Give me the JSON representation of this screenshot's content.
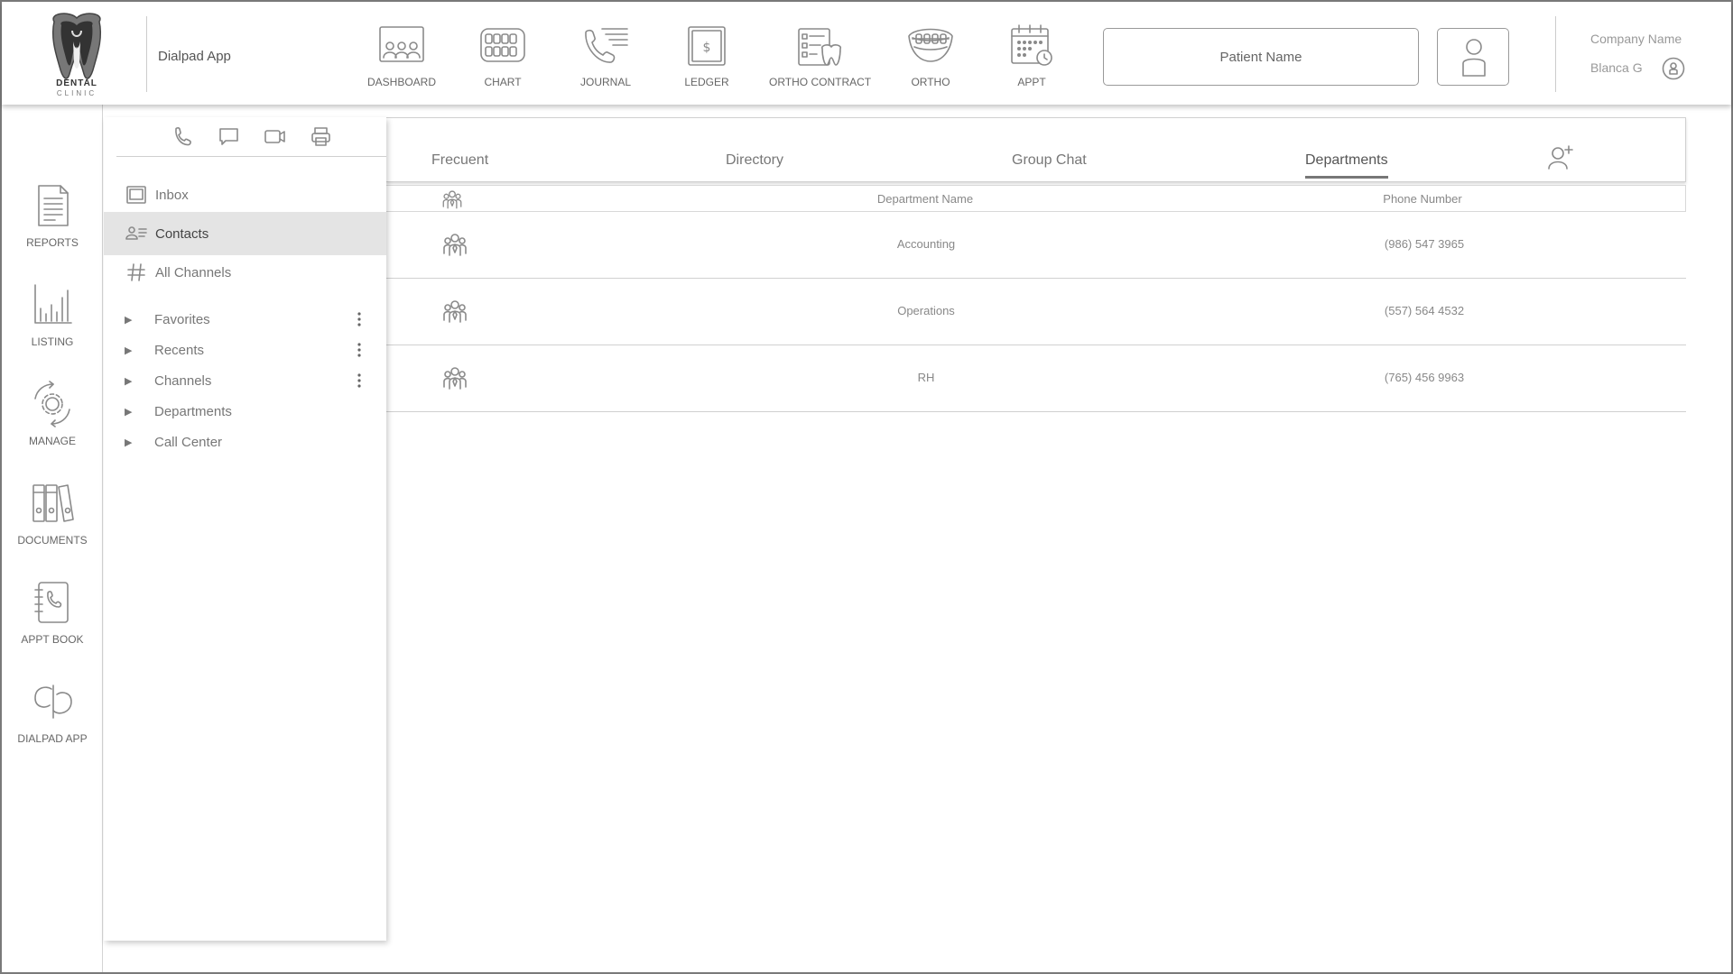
{
  "logo": {
    "text": "DENTAL",
    "subtext": "CLINIC"
  },
  "app_title": "Dialpad App",
  "top_nav": [
    {
      "label": "DASHBOARD",
      "icon": "dashboard-icon"
    },
    {
      "label": "CHART",
      "icon": "teeth-chart-icon"
    },
    {
      "label": "JOURNAL",
      "icon": "journal-icon"
    },
    {
      "label": "LEDGER",
      "icon": "ledger-icon"
    },
    {
      "label": "ORTHO CONTRACT",
      "icon": "ortho-contract-icon"
    },
    {
      "label": "ORTHO",
      "icon": "braces-icon"
    },
    {
      "label": "APPT",
      "icon": "calendar-icon"
    }
  ],
  "patient_search": {
    "placeholder": "Patient Name"
  },
  "account": {
    "company": "Company Name",
    "user": "Blanca G"
  },
  "left_rail": [
    {
      "label": "REPORTS",
      "icon": "report-icon"
    },
    {
      "label": "LISTING",
      "icon": "bar-chart-icon"
    },
    {
      "label": "MANAGE",
      "icon": "gear-cycle-icon"
    },
    {
      "label": "DOCUMENTS",
      "icon": "binders-icon"
    },
    {
      "label": "APPT BOOK",
      "icon": "phone-book-icon"
    },
    {
      "label": "DIALPAD APP",
      "icon": "dialpad-icon"
    }
  ],
  "comm_icons": [
    "phone-icon",
    "chat-icon",
    "video-icon",
    "printer-icon"
  ],
  "side_menu": {
    "inbox": "Inbox",
    "contacts": "Contacts",
    "all_channels": "All Channels",
    "active": "Contacts"
  },
  "tree": [
    {
      "label": "Favorites",
      "has_menu": true
    },
    {
      "label": "Recents",
      "has_menu": true
    },
    {
      "label": "Channels",
      "has_menu": true
    },
    {
      "label": "Departments",
      "has_menu": false
    },
    {
      "label": "Call Center",
      "has_menu": false
    }
  ],
  "tabs": {
    "frecuent": "Frecuent",
    "directory": "Directory",
    "group_chat": "Group Chat",
    "departments": "Departments",
    "active": "Departments"
  },
  "table": {
    "headers": {
      "name": "Department Name",
      "phone": "Phone Number"
    },
    "rows": [
      {
        "name": "Accounting",
        "phone": "(986) 547 3965"
      },
      {
        "name": "Operations",
        "phone": "(557) 564 4532"
      },
      {
        "name": "RH",
        "phone": "(765) 456 9963"
      }
    ]
  }
}
